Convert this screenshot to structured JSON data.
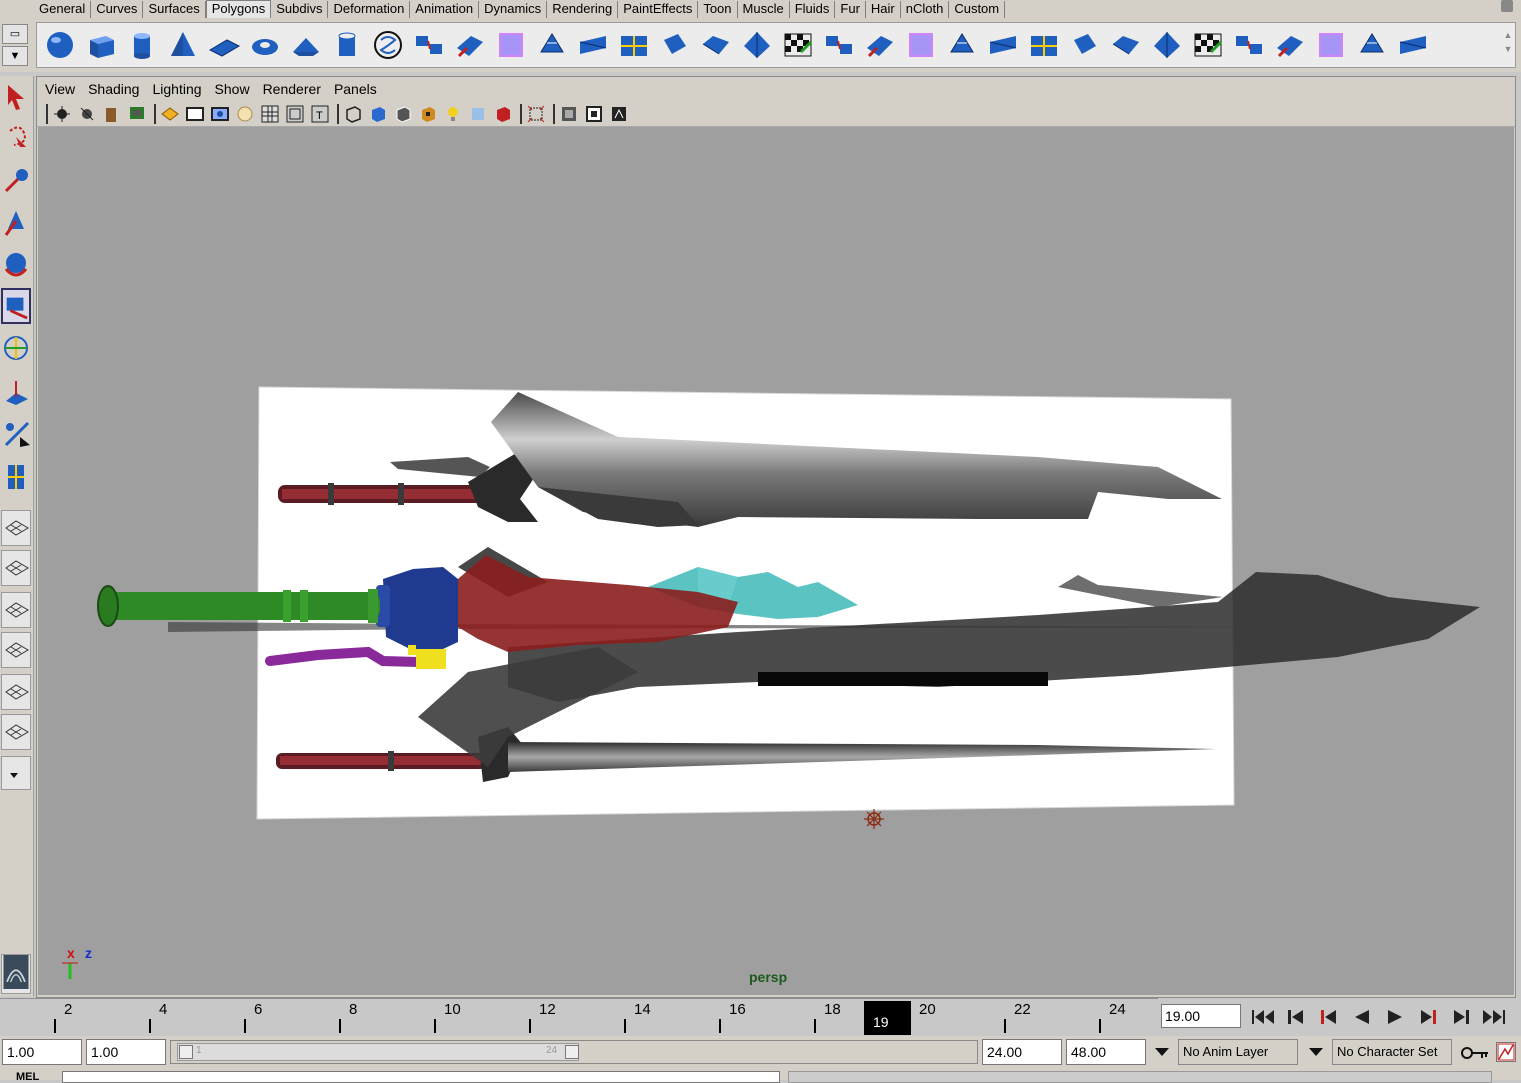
{
  "shelf": {
    "tabs": [
      "General",
      "Curves",
      "Surfaces",
      "Polygons",
      "Subdivs",
      "Deformation",
      "Animation",
      "Dynamics",
      "Rendering",
      "PaintEffects",
      "Toon",
      "Muscle",
      "Fluids",
      "Fur",
      "Hair",
      "nCloth",
      "Custom"
    ],
    "active_tab": "Polygons",
    "icons": [
      "poly-sphere-icon",
      "poly-cube-icon",
      "poly-cylinder-icon",
      "poly-cone-icon",
      "poly-plane-icon",
      "poly-torus-icon",
      "poly-prism-icon",
      "poly-pipe-icon",
      "poly-helix-icon",
      "combine-icon",
      "separate-icon",
      "extract-icon",
      "smooth-icon",
      "triangulate-icon",
      "quadrangulate-icon",
      "extrude-icon",
      "bridge-icon",
      "append-polygon-icon",
      "split-polygon-icon",
      "insert-edge-loop-icon",
      "offset-edge-loop-icon",
      "merge-icon",
      "bevel-icon",
      "chamfer-icon",
      "sculpt-geometry-icon",
      "paint-selection-icon",
      "create-uvs-planar-icon",
      "create-uvs-cylindrical-icon",
      "uv-texture-editor-icon",
      "checker-uv-icon",
      "checker-uv-2-icon",
      "checker-uv-3-icon",
      "uv-snapshot-icon",
      "uv-layout-icon"
    ]
  },
  "toolbox": {
    "tools": [
      "select-tool-icon",
      "lasso-tool-icon",
      "paint-select-tool-icon",
      "move-tool-icon",
      "rotate-tool-icon",
      "scale-tool-icon",
      "universal-manipulator-icon",
      "soft-modification-icon",
      "show-manipulator-icon",
      "last-tool-icon"
    ],
    "layouts": [
      "single-perspective-layout-icon",
      "four-view-layout-icon",
      "persp-outliner-layout-icon",
      "persp-graph-layout-icon",
      "hypershade-layout-icon",
      "persp-graph-hypershade-layout-icon"
    ]
  },
  "panel": {
    "menu": [
      "View",
      "Shading",
      "Lighting",
      "Show",
      "Renderer",
      "Panels"
    ],
    "toolbar_icons": [
      "select-camera-icon",
      "camera-attributes-icon",
      "bookmark-icon",
      "image-plane-icon",
      "grid-icon",
      "film-gate-icon",
      "resolution-gate-icon",
      "gate-mask-icon",
      "field-chart-icon",
      "safe-action-icon",
      "safe-title-icon",
      "wireframe-icon",
      "smooth-shade-icon",
      "wireframe-on-shaded-icon",
      "textured-icon",
      "use-all-lights-icon",
      "shadows-icon",
      "xray-icon",
      "isolate-select-icon",
      "high-quality-icon",
      "shadows-2-icon",
      "ambient-occlusion-icon"
    ],
    "camera_label": "persp",
    "axis_x": "x",
    "axis_z": "z"
  },
  "timeline": {
    "ticks": [
      "2",
      "4",
      "6",
      "8",
      "10",
      "12",
      "14",
      "16",
      "18",
      "20",
      "22",
      "24"
    ],
    "current_frame": "19",
    "current_time_field": "19.00",
    "playback_buttons": [
      "go-to-start-icon",
      "step-back-key-icon",
      "step-back-frame-icon",
      "play-backwards-icon",
      "play-forwards-icon",
      "step-forward-frame-icon",
      "step-forward-key-icon",
      "go-to-end-icon"
    ]
  },
  "range": {
    "start_time": "1.00",
    "playback_start": "1.00",
    "slider_start_label": "1",
    "slider_end_label": "24",
    "playback_end": "24.00",
    "end_time": "48.00",
    "anim_layer": "No Anim Layer",
    "character_set": "No Character Set"
  },
  "command": {
    "label": "MEL"
  },
  "colors": {
    "viewport_bg": "#9f9f9f",
    "ui_bg": "#d4d0c8",
    "accent_blue": "#1f5fbf",
    "grip_green": "#2e8a24",
    "hilt_red": "#8b1e1e",
    "guard_blue": "#203a90",
    "cable_purple": "#8a2a9a",
    "crystal_teal": "#3fb8b8"
  }
}
